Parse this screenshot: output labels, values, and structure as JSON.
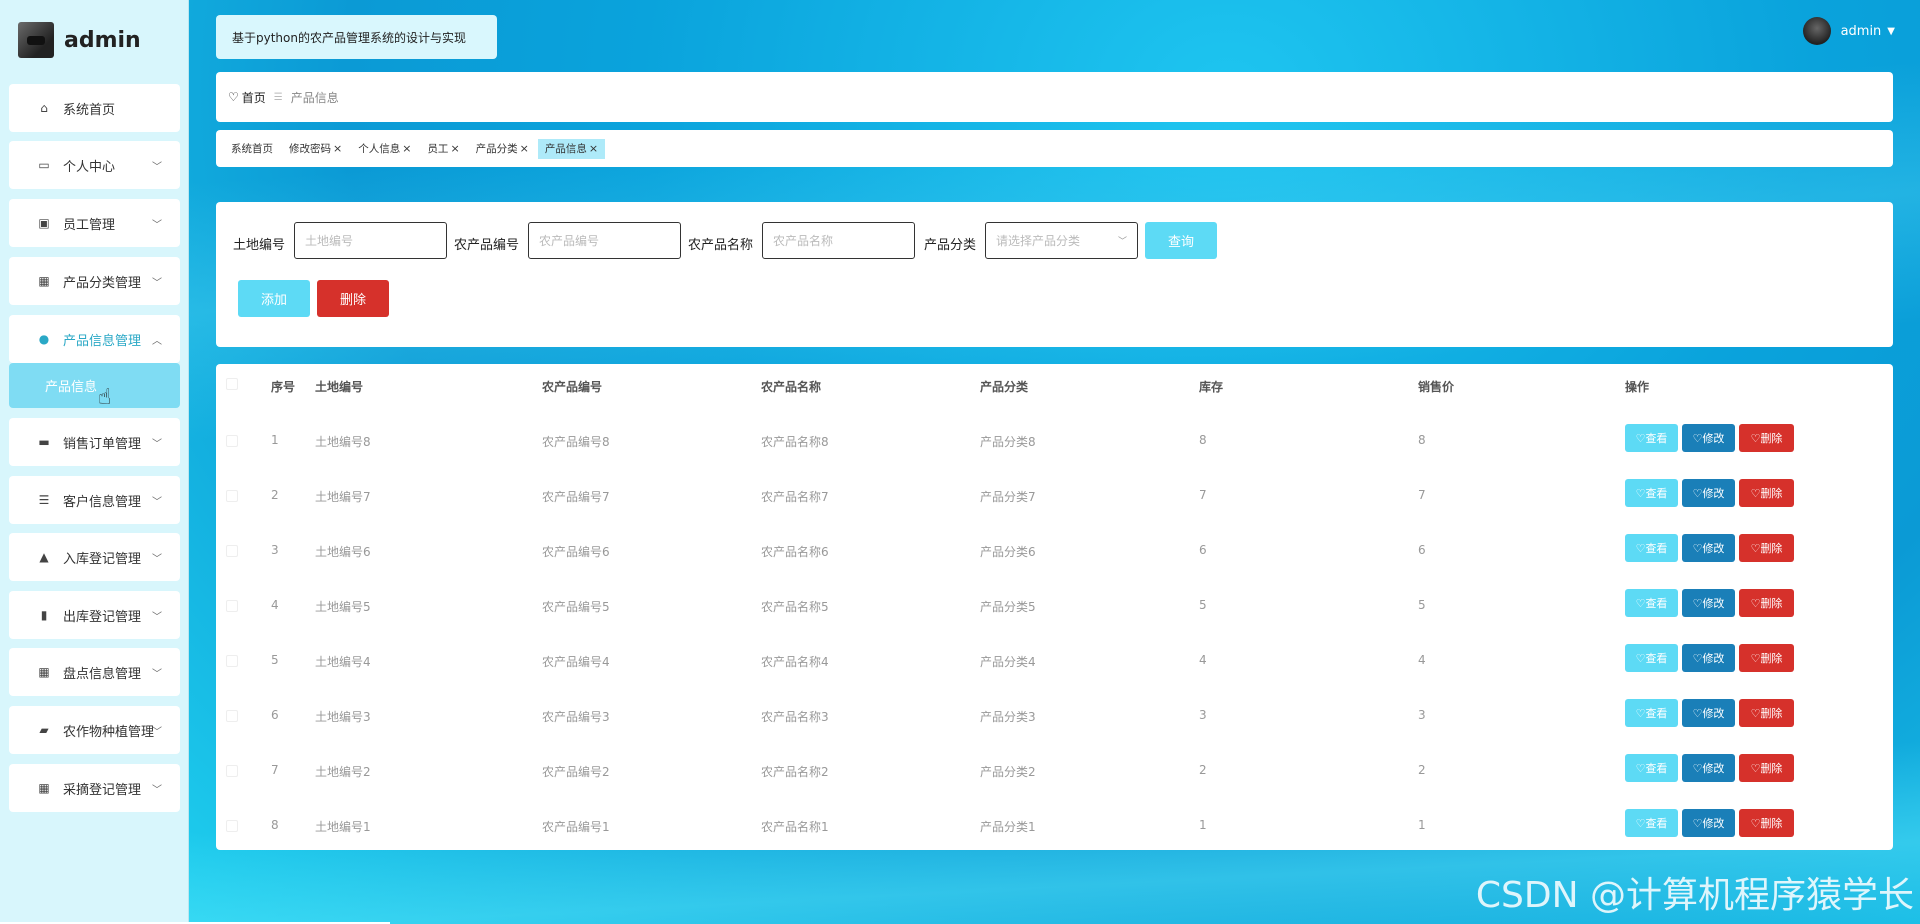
{
  "app": {
    "name": "admin",
    "title": "基于python的农产品管理系统的设计与实现",
    "user": "admin"
  },
  "sidebar": {
    "items": [
      {
        "label": "系统首页",
        "icon": "home-icon",
        "glyph": "⌂"
      },
      {
        "label": "个人中心",
        "icon": "card-icon",
        "glyph": "▭"
      },
      {
        "label": "员工管理",
        "icon": "clipboard-icon",
        "glyph": "▣"
      },
      {
        "label": "产品分类管理",
        "icon": "grid-icon",
        "glyph": "▦"
      },
      {
        "label": "产品信息管理",
        "icon": "user-icon",
        "glyph": "●"
      },
      {
        "label": "销售订单管理",
        "icon": "briefcase-icon",
        "glyph": "▬"
      },
      {
        "label": "客户信息管理",
        "icon": "list-icon",
        "glyph": "☰"
      },
      {
        "label": "入库登记管理",
        "icon": "person-icon",
        "glyph": "▲"
      },
      {
        "label": "出库登记管理",
        "icon": "bars-icon",
        "glyph": "▮"
      },
      {
        "label": "盘点信息管理",
        "icon": "grid-icon",
        "glyph": "▦"
      },
      {
        "label": "农作物种植管理",
        "icon": "wallet-icon",
        "glyph": "▰"
      },
      {
        "label": "采摘登记管理",
        "icon": "grid-icon",
        "glyph": "▦"
      }
    ],
    "sub_item": "产品信息"
  },
  "breadcrumb": {
    "home": "首页",
    "current": "产品信息"
  },
  "tabs": [
    {
      "label": "系统首页",
      "closable": false
    },
    {
      "label": "修改密码",
      "closable": true
    },
    {
      "label": "个人信息",
      "closable": true
    },
    {
      "label": "员工",
      "closable": true
    },
    {
      "label": "产品分类",
      "closable": true
    },
    {
      "label": "产品信息",
      "closable": true,
      "active": true
    }
  ],
  "search": {
    "land_label": "土地编号",
    "land_placeholder": "土地编号",
    "prod_label": "农产品编号",
    "prod_placeholder": "农产品编号",
    "name_label": "农产品名称",
    "name_placeholder": "农产品名称",
    "cat_label": "产品分类",
    "cat_placeholder": "请选择产品分类",
    "query": "查询",
    "add": "添加",
    "delete": "删除"
  },
  "table": {
    "headers": [
      "序号",
      "土地编号",
      "农产品编号",
      "农产品名称",
      "产品分类",
      "库存",
      "销售价",
      "操作"
    ],
    "rows": [
      [
        "1",
        "土地编号8",
        "农产品编号8",
        "农产品名称8",
        "产品分类8",
        "8",
        "8"
      ],
      [
        "2",
        "土地编号7",
        "农产品编号7",
        "农产品名称7",
        "产品分类7",
        "7",
        "7"
      ],
      [
        "3",
        "土地编号6",
        "农产品编号6",
        "农产品名称6",
        "产品分类6",
        "6",
        "6"
      ],
      [
        "4",
        "土地编号5",
        "农产品编号5",
        "农产品名称5",
        "产品分类5",
        "5",
        "5"
      ],
      [
        "5",
        "土地编号4",
        "农产品编号4",
        "农产品名称4",
        "产品分类4",
        "4",
        "4"
      ],
      [
        "6",
        "土地编号3",
        "农产品编号3",
        "农产品名称3",
        "产品分类3",
        "3",
        "3"
      ],
      [
        "7",
        "土地编号2",
        "农产品编号2",
        "农产品名称2",
        "产品分类2",
        "2",
        "2"
      ],
      [
        "8",
        "土地编号1",
        "农产品编号1",
        "农产品名称1",
        "产品分类1",
        "1",
        "1"
      ]
    ],
    "actions": {
      "view": "查看",
      "edit": "修改",
      "delete": "删除"
    }
  },
  "watermark": "CSDN @计算机程序猿学长",
  "colors": {
    "accent": "#5ddaf5",
    "edit": "#1a7fb8",
    "danger": "#d6312b",
    "sidebar": "#d8f6fc"
  }
}
